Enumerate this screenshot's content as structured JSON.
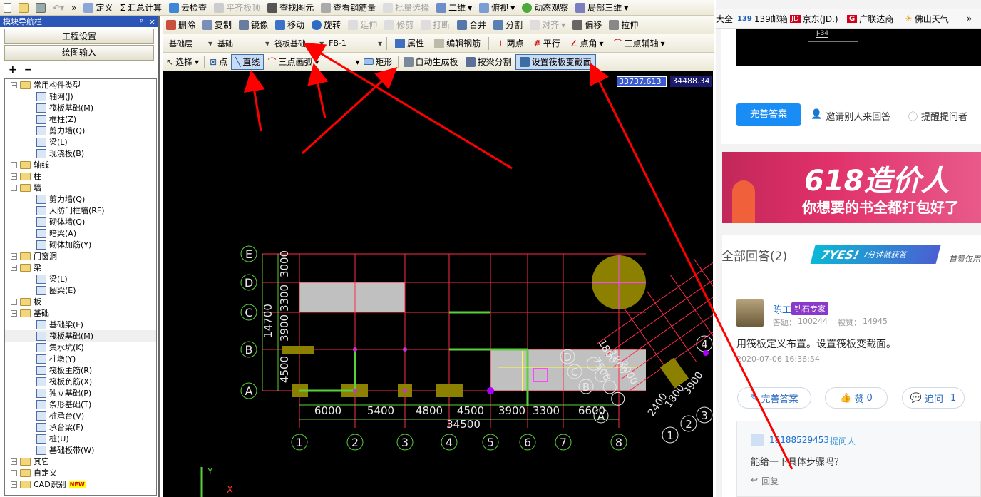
{
  "menubar": {
    "items": [
      "定义",
      "汇总计算",
      "云检查",
      "平齐板顶",
      "查找图元",
      "查看钢筋量",
      "批量选择",
      "二维",
      "俯视",
      "动态观察",
      "局部三维"
    ]
  },
  "toolbar2": {
    "items": [
      "删除",
      "复制",
      "镜像",
      "移动",
      "旋转",
      "延伸",
      "修剪",
      "打断",
      "合并",
      "分割",
      "对齐",
      "偏移",
      "拉伸"
    ]
  },
  "toolbar3": {
    "floor": "基础层",
    "category": "基础",
    "type": "筏板基础",
    "name": "FB-1",
    "items": [
      "属性",
      "编辑钢筋",
      "两点",
      "平行",
      "点角",
      "三点辅轴"
    ]
  },
  "toolbar4": {
    "select": "选择",
    "point": "点",
    "line": "直线",
    "arc": "三点画弧",
    "rect": "矩形",
    "auto": "自动生成板",
    "split": "按梁分割",
    "set_section": "设置筏板变截面"
  },
  "nav": {
    "title": "模块导航栏",
    "pin": "ᵖ",
    "close": "×",
    "btn_project": "工程设置",
    "btn_draw": "绘图输入",
    "add": "+",
    "remove": "−"
  },
  "tree": [
    {
      "label": "常用构件类型",
      "level": 0,
      "folder": true,
      "exp": "−"
    },
    {
      "label": "轴网(J)",
      "level": 1
    },
    {
      "label": "筏板基础(M)",
      "level": 1
    },
    {
      "label": "框柱(Z)",
      "level": 1
    },
    {
      "label": "剪力墙(Q)",
      "level": 1
    },
    {
      "label": "梁(L)",
      "level": 1
    },
    {
      "label": "现浇板(B)",
      "level": 1
    },
    {
      "label": "轴线",
      "level": 0,
      "folder": true,
      "exp": "+"
    },
    {
      "label": "柱",
      "level": 0,
      "folder": true,
      "exp": "+"
    },
    {
      "label": "墙",
      "level": 0,
      "folder": true,
      "exp": "−"
    },
    {
      "label": "剪力墙(Q)",
      "level": 1
    },
    {
      "label": "人防门框墙(RF)",
      "level": 1
    },
    {
      "label": "砌体墙(Q)",
      "level": 1
    },
    {
      "label": "暗梁(A)",
      "level": 1
    },
    {
      "label": "砌体加筋(Y)",
      "level": 1
    },
    {
      "label": "门窗洞",
      "level": 0,
      "folder": true,
      "exp": "+"
    },
    {
      "label": "梁",
      "level": 0,
      "folder": true,
      "exp": "−"
    },
    {
      "label": "梁(L)",
      "level": 1
    },
    {
      "label": "圈梁(E)",
      "level": 1
    },
    {
      "label": "板",
      "level": 0,
      "folder": true,
      "exp": "+"
    },
    {
      "label": "基础",
      "level": 0,
      "folder": true,
      "exp": "−"
    },
    {
      "label": "基础梁(F)",
      "level": 1
    },
    {
      "label": "筏板基础(M)",
      "level": 1,
      "selected": true
    },
    {
      "label": "集水坑(K)",
      "level": 1
    },
    {
      "label": "柱墩(Y)",
      "level": 1
    },
    {
      "label": "筏板主筋(R)",
      "level": 1
    },
    {
      "label": "筏板负筋(X)",
      "level": 1
    },
    {
      "label": "独立基础(P)",
      "level": 1
    },
    {
      "label": "条形基础(T)",
      "level": 1
    },
    {
      "label": "桩承台(V)",
      "level": 1
    },
    {
      "label": "承台梁(F)",
      "level": 1
    },
    {
      "label": "桩(U)",
      "level": 1
    },
    {
      "label": "基础板带(W)",
      "level": 1
    },
    {
      "label": "其它",
      "level": 0,
      "folder": true,
      "exp": "+"
    },
    {
      "label": "自定义",
      "level": 0,
      "folder": true,
      "exp": "+"
    },
    {
      "label": "CAD识别",
      "level": 0,
      "folder": true,
      "exp": "+",
      "new": "NEW"
    }
  ],
  "cad": {
    "coord_x": "33737.613",
    "coord_y": "34488.34",
    "row_axes": [
      "E",
      "D",
      "C",
      "B",
      "A"
    ],
    "col_axes": [
      "1",
      "2",
      "3",
      "4",
      "5",
      "6",
      "7",
      "8"
    ],
    "spacings": [
      "6000",
      "5400",
      "4800",
      "4500",
      "3900",
      "3300",
      "6600"
    ],
    "total": "34500",
    "row_dims": [
      "3000",
      "3300",
      "3900",
      "4500"
    ],
    "left_total": "14700",
    "rot_axes_letters": [
      "D",
      "C",
      "B",
      "A"
    ],
    "rot_axes_nums": [
      "1",
      "2",
      "3",
      "4"
    ],
    "rot_dims": [
      "1800",
      "1800",
      "3000",
      "7500"
    ],
    "rot_bottom_dims": [
      "2400",
      "1800",
      "3900"
    ],
    "axis_y": "Y",
    "axis_x": "X"
  },
  "browser": {
    "bookmarks": [
      "大全",
      "139邮箱",
      "京东(JD.)",
      "广联达商",
      "佛山天气"
    ],
    "more": "»"
  },
  "qa": {
    "improve_btn": "完善答案",
    "invite": "邀请别人来回答",
    "remind": "提醒提问者",
    "banner_big": "618造价人",
    "banner_sub": "你想要的书全都打包好了",
    "answers_header": "全部回答(2)",
    "yes_badge": "7YES!",
    "yes_sub": "7分钟就获答",
    "first_tag": "首赞仅用",
    "user": "陈工",
    "badge": "钻石专家",
    "answered_label": "答题：",
    "answered": "100244",
    "liked_label": "被赞：",
    "liked": "14945",
    "answer": "用筏板定义布置。设置筏板变截面。",
    "date": "2020-07-06 16:36:54",
    "improve_pill": "完善答案",
    "like_pill": "赞",
    "like_count": "0",
    "follow_pill": "追问",
    "follow_count": "1",
    "comment_user": "18188529453",
    "comment_tag": "提问人",
    "comment_text": "能给一下具体步骤吗？",
    "reply": "回复"
  },
  "colors": {
    "nav_blue": "#2a56b8",
    "accent": "#1a8cf5",
    "arrow": "#ff0000",
    "grid": "#ff2b48",
    "fill": "#c0c0c0",
    "olive": "#8b8000"
  }
}
